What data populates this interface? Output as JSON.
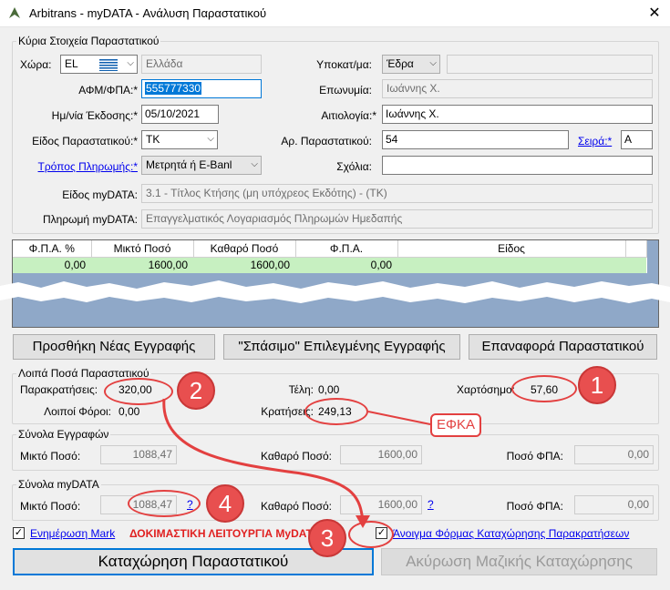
{
  "window": {
    "title": "Arbitrans - myDATA - Ανάλυση Παραστατικού",
    "close": "✕"
  },
  "main_group": {
    "title": "Κύρια Στοιχεία Παραστατικού",
    "country_label": "Χώρα:",
    "country_code": "EL",
    "country_name": "Ελλάδα",
    "afm_label": "ΑΦΜ/ΦΠΑ:*",
    "afm_value": "555777330",
    "date_label": "Ημ/νία Έκδοσης:*",
    "date_value": "05/10/2021",
    "doc_type_label": "Είδος Παραστατικού:*",
    "doc_type_value": "TK",
    "payment_label": "Τρόπος Πληρωμής:*",
    "payment_value": "Μετρητά ή E-Banl",
    "branch_label": "Υποκατ/μα:",
    "branch_value": "Έδρα",
    "branch_extra": "",
    "name_label": "Επωνυμία:",
    "name_value": "Ιωάννης Χ.",
    "reason_label": "Αιτιολογία:*",
    "reason_value": "Ιωάννης Χ.",
    "docnum_label": "Αρ. Παραστατικού:",
    "docnum_value": "54",
    "series_label": "Σειρά:*",
    "series_value": "A",
    "comments_label": "Σχόλια:",
    "comments_value": "",
    "mydata_type_label": "Είδος myDATA:",
    "mydata_type_value": "3.1 - Τίτλος Κτήσης (μη υπόχρεος Εκδότης) - (ΤΚ)",
    "mydata_pay_label": "Πληρωμή myDATA:",
    "mydata_pay_value": "Επαγγελματικός Λογαριασμός Πληρωμών Ημεδαπής"
  },
  "grid": {
    "headers": [
      "Φ.Π.Α. %",
      "Μικτό Ποσό",
      "Καθαρό Ποσό",
      "Φ.Π.Α.",
      "Είδος"
    ],
    "row": [
      "0,00",
      "1600,00",
      "1600,00",
      "0,00",
      ""
    ]
  },
  "buttons": {
    "add": "Προσθήκη Νέας Εγγραφής",
    "split": "\"Σπάσιμο\" Επιλεγμένης Εγγραφής",
    "restore": "Επαναφορά Παραστατικού",
    "submit": "Καταχώρηση Παραστατικού",
    "cancel_bulk": "Ακύρωση Μαζικής Καταχώρησης"
  },
  "other_amounts": {
    "title": "Λοιπά Ποσά Παραστατικού",
    "withholding_label": "Παρακρατήσεις:",
    "withholding_value": "320,00",
    "other_taxes_label": "Λοιποί Φόροι:",
    "other_taxes_value": "0,00",
    "fees_label": "Τέλη:",
    "fees_value": "0,00",
    "deductions_label": "Κρατήσεις:",
    "deductions_value": "249,13",
    "stamp_label": "Χαρτόσημο:",
    "stamp_value": "57,60"
  },
  "totals_entries": {
    "title": "Σύνολα Εγγραφών",
    "gross_label": "Μικτό Ποσό:",
    "gross_value": "1088,47",
    "net_label": "Καθαρό Ποσό:",
    "net_value": "1600,00",
    "vat_label": "Ποσό ΦΠΑ:",
    "vat_value": "0,00"
  },
  "totals_mydata": {
    "title": "Σύνολα myDATA",
    "gross_label": "Μικτό Ποσό:",
    "gross_value": "1088,47",
    "net_label": "Καθαρό Ποσό:",
    "net_value": "1600,00",
    "vat_label": "Ποσό ΦΠΑ:",
    "vat_value": "0,00",
    "q": "?"
  },
  "footer": {
    "update_mark": "Ενημέρωση Mark",
    "test_mode": "ΔΟΚΙΜΑΣΤΙΚΗ ΛΕΙΤΟΥΡΓΙΑ MyDATA",
    "open_form": "Άνοιγμα Φόρμας Καταχώρησης Παρακρατήσεων"
  },
  "annotations": {
    "n1": "1",
    "n2": "2",
    "n3": "3",
    "n4": "4",
    "efka": "ΕΦΚΑ",
    "color": "#e34040"
  }
}
